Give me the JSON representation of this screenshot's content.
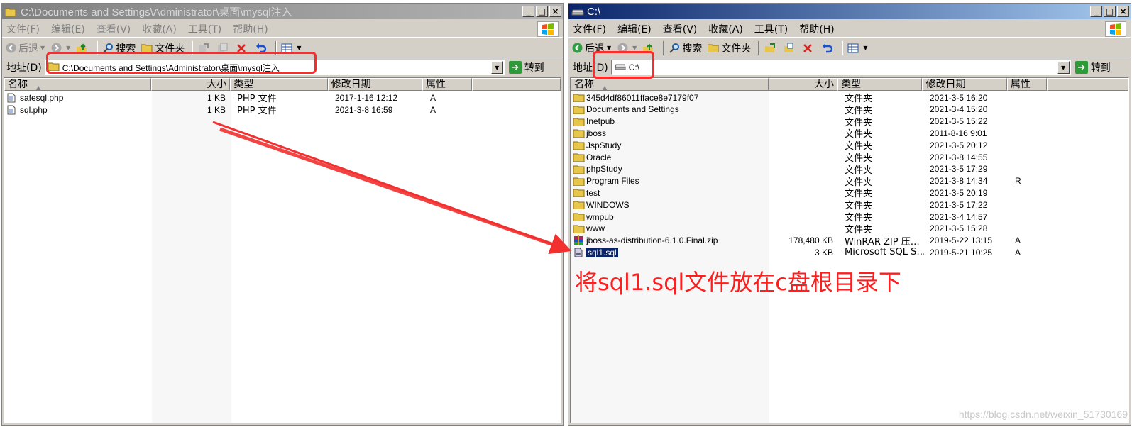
{
  "left_window": {
    "title": "C:\\Documents and Settings\\Administrator\\桌面\\mysql注入",
    "menu": [
      "文件(F)",
      "编辑(E)",
      "查看(V)",
      "收藏(A)",
      "工具(T)",
      "帮助(H)"
    ],
    "toolbar": {
      "back": "后退",
      "search": "搜索",
      "folders": "文件夹"
    },
    "address_label": "地址(D)",
    "address_value": "C:\\Documents and Settings\\Administrator\\桌面\\mysql注入",
    "go_label": "转到",
    "columns": [
      "名称",
      "大小",
      "类型",
      "修改日期",
      "属性"
    ],
    "files": [
      {
        "name": "safesql.php",
        "size": "1 KB",
        "type": "PHP 文件",
        "date": "2017-1-16 12:12",
        "attr": "A"
      },
      {
        "name": "sql.php",
        "size": "1 KB",
        "type": "PHP 文件",
        "date": "2021-3-8 16:59",
        "attr": "A"
      }
    ]
  },
  "right_window": {
    "title": "C:\\",
    "menu": [
      "文件(F)",
      "编辑(E)",
      "查看(V)",
      "收藏(A)",
      "工具(T)",
      "帮助(H)"
    ],
    "toolbar": {
      "back": "后退",
      "search": "搜索",
      "folders": "文件夹"
    },
    "address_label": "地址(D)",
    "address_value": "C:\\",
    "go_label": "转到",
    "columns": [
      "名称",
      "大小",
      "类型",
      "修改日期",
      "属性"
    ],
    "files": [
      {
        "name": "345d4df86011fface8e7179f07",
        "size": "",
        "type": "文件夹",
        "date": "2021-3-5 16:20",
        "attr": "",
        "icon": "folder-icon"
      },
      {
        "name": "Documents and Settings",
        "size": "",
        "type": "文件夹",
        "date": "2021-3-4 15:20",
        "attr": "",
        "icon": "folder-icon"
      },
      {
        "name": "Inetpub",
        "size": "",
        "type": "文件夹",
        "date": "2021-3-5 15:22",
        "attr": "",
        "icon": "folder-icon"
      },
      {
        "name": "jboss",
        "size": "",
        "type": "文件夹",
        "date": "2011-8-16 9:01",
        "attr": "",
        "icon": "folder-icon"
      },
      {
        "name": "JspStudy",
        "size": "",
        "type": "文件夹",
        "date": "2021-3-5 20:12",
        "attr": "",
        "icon": "folder-icon"
      },
      {
        "name": "Oracle",
        "size": "",
        "type": "文件夹",
        "date": "2021-3-8 14:55",
        "attr": "",
        "icon": "folder-icon"
      },
      {
        "name": "phpStudy",
        "size": "",
        "type": "文件夹",
        "date": "2021-3-5 17:29",
        "attr": "",
        "icon": "folder-icon"
      },
      {
        "name": "Program Files",
        "size": "",
        "type": "文件夹",
        "date": "2021-3-8 14:34",
        "attr": "R",
        "icon": "folder-icon"
      },
      {
        "name": "test",
        "size": "",
        "type": "文件夹",
        "date": "2021-3-5 20:19",
        "attr": "",
        "icon": "folder-icon"
      },
      {
        "name": "WINDOWS",
        "size": "",
        "type": "文件夹",
        "date": "2021-3-5 17:22",
        "attr": "",
        "icon": "folder-icon"
      },
      {
        "name": "wmpub",
        "size": "",
        "type": "文件夹",
        "date": "2021-3-4 14:57",
        "attr": "",
        "icon": "folder-icon"
      },
      {
        "name": "www",
        "size": "",
        "type": "文件夹",
        "date": "2021-3-5 15:28",
        "attr": "",
        "icon": "folder-icon"
      },
      {
        "name": "jboss-as-distribution-6.1.0.Final.zip",
        "size": "178,480 KB",
        "type": "WinRAR ZIP 压…",
        "date": "2019-5-22 13:15",
        "attr": "A",
        "icon": "winrar-icon"
      },
      {
        "name": "sql1.sql",
        "size": "3 KB",
        "type": "Microsoft SQL S…",
        "date": "2019-5-21 10:25",
        "attr": "A",
        "icon": "sql-file-icon",
        "selected": true
      }
    ]
  },
  "annotation": {
    "note": "将sql1.sql文件放在c盘根目录下",
    "highlight_color": "#ff2a2a"
  },
  "watermark": "https://blog.csdn.net/weixin_51730169"
}
